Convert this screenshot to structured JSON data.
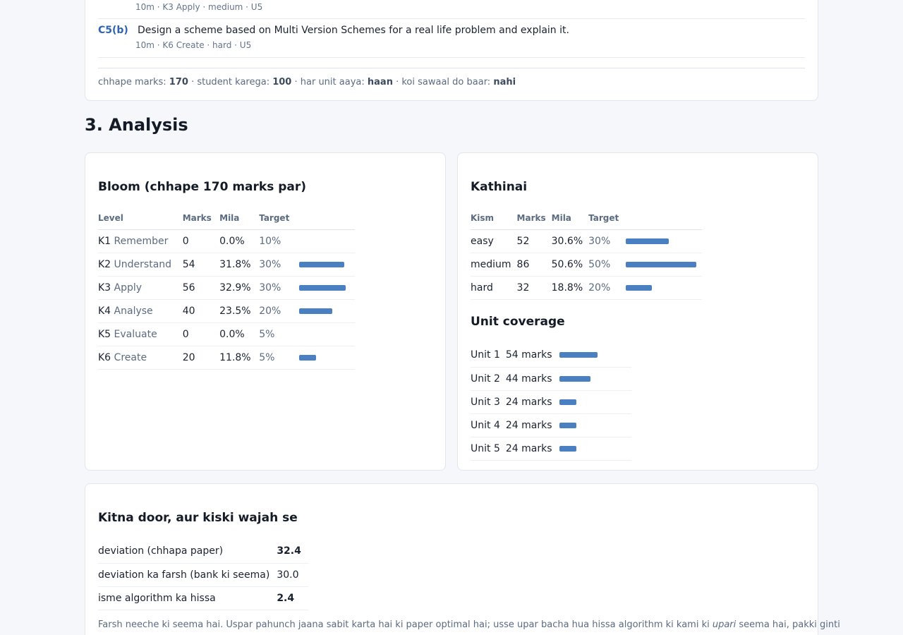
{
  "questions": [
    {
      "num": "",
      "text": "",
      "meta": "10m · K3 Apply · medium · U5"
    },
    {
      "num": "C5(b)",
      "text": "Design a scheme based on Multi Version Schemes for a real life problem and explain it.",
      "meta": "10m · K6 Create · hard · U5"
    }
  ],
  "summary": {
    "printed_label": "chhape marks:",
    "printed_value": "170",
    "student_label": "· student karega:",
    "student_value": "100",
    "units_label": "· har unit aaya:",
    "units_value": "haan",
    "repeat_label": "· koi sawaal do baar:",
    "repeat_value": "nahi"
  },
  "section_title": "3. Analysis",
  "bloom": {
    "title": "Bloom (chhape 170 marks par)",
    "headers": [
      "Level",
      "Marks",
      "Mila",
      "Target"
    ],
    "rows": [
      {
        "code": "K1",
        "name": "Remember",
        "marks": "0",
        "mila": "0.0%",
        "target": "10%",
        "fraction": 0.0
      },
      {
        "code": "K2",
        "name": "Understand",
        "marks": "54",
        "mila": "31.8%",
        "target": "30%",
        "fraction": 0.318
      },
      {
        "code": "K3",
        "name": "Apply",
        "marks": "56",
        "mila": "32.9%",
        "target": "30%",
        "fraction": 0.329
      },
      {
        "code": "K4",
        "name": "Analyse",
        "marks": "40",
        "mila": "23.5%",
        "target": "20%",
        "fraction": 0.235
      },
      {
        "code": "K5",
        "name": "Evaluate",
        "marks": "0",
        "mila": "0.0%",
        "target": "5%",
        "fraction": 0.0
      },
      {
        "code": "K6",
        "name": "Create",
        "marks": "20",
        "mila": "11.8%",
        "target": "5%",
        "fraction": 0.118
      }
    ]
  },
  "difficulty": {
    "title": "Kathinai",
    "headers": [
      "Kism",
      "Marks",
      "Mila",
      "Target"
    ],
    "rows": [
      {
        "kind": "easy",
        "marks": "52",
        "mila": "30.6%",
        "target": "30%",
        "fraction": 0.306
      },
      {
        "kind": "medium",
        "marks": "86",
        "mila": "50.6%",
        "target": "50%",
        "fraction": 0.506
      },
      {
        "kind": "hard",
        "marks": "32",
        "mila": "18.8%",
        "target": "20%",
        "fraction": 0.188
      }
    ]
  },
  "units": {
    "title": "Unit coverage",
    "rows": [
      {
        "unit": "Unit 1",
        "marks": "54 marks",
        "value": 54
      },
      {
        "unit": "Unit 2",
        "marks": "44 marks",
        "value": 44
      },
      {
        "unit": "Unit 3",
        "marks": "24 marks",
        "value": 24
      },
      {
        "unit": "Unit 4",
        "marks": "24 marks",
        "value": 24
      },
      {
        "unit": "Unit 5",
        "marks": "24 marks",
        "value": 24
      }
    ]
  },
  "deviation": {
    "title": "Kitna door, aur kiski wajah se",
    "rows": [
      {
        "label": "deviation (chhapa paper)",
        "value": "32.4",
        "bold": true
      },
      {
        "label": "deviation ka farsh (bank ki seema)",
        "value": "30.0",
        "bold": false
      },
      {
        "label": "isme algorithm ka hissa",
        "value": "2.4",
        "bold": true
      }
    ],
    "note_before": "Farsh neeche ki seema hai. Uspar pahunch jaana sabit karta hai ki paper optimal hai; usse upar bacha hua hissa algorithm ki kami ki ",
    "note_em": "upari",
    "note_after": " seema hai, pakki ginti"
  },
  "colors": {
    "bar": "#4a7fc1",
    "accent": "#2f64b0"
  }
}
